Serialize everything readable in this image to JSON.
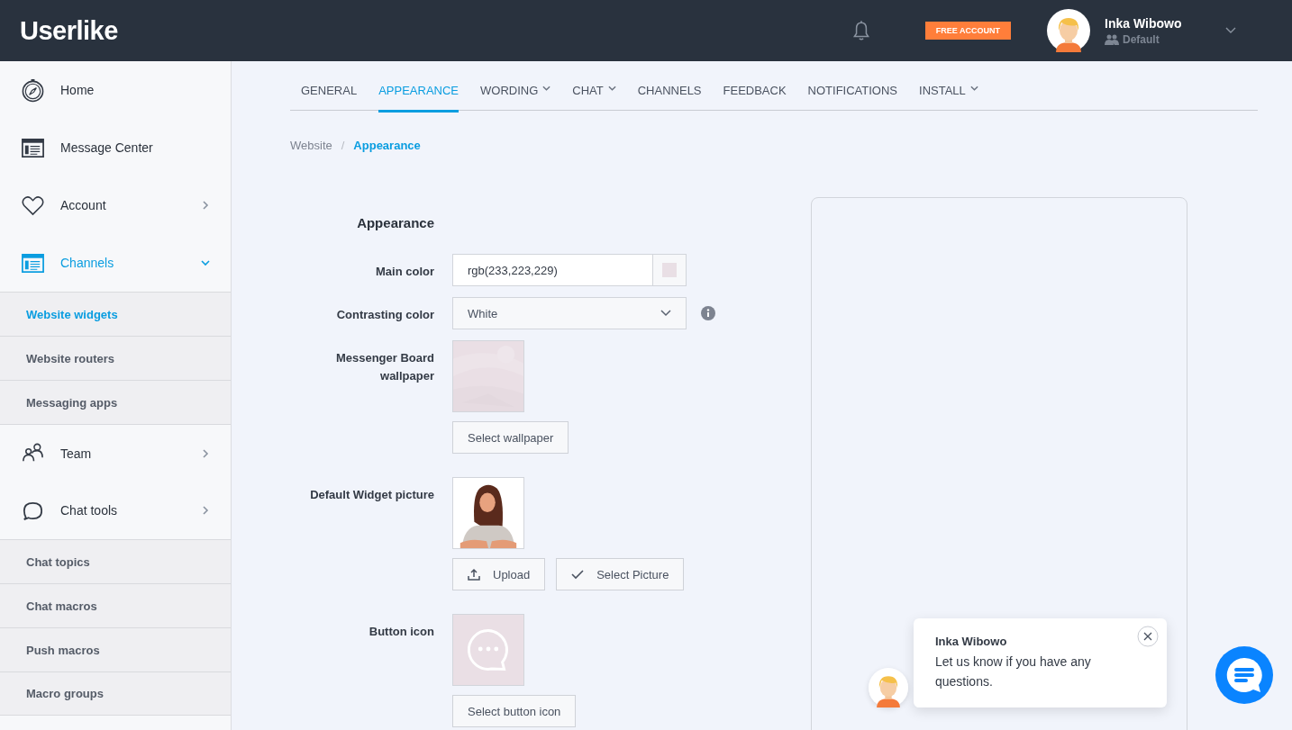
{
  "header": {
    "logo": "Userlike",
    "badge": "FREE ACCOUNT",
    "user": {
      "name": "Inka Wibowo",
      "role": "Default"
    }
  },
  "sidebar": {
    "items": [
      {
        "label": "Home",
        "selected": false
      },
      {
        "label": "Message Center",
        "selected": false
      },
      {
        "label": "Account",
        "selected": false,
        "expanded": false
      },
      {
        "label": "Channels",
        "selected": true,
        "expanded": true,
        "children": [
          {
            "label": "Website widgets",
            "selected": true
          },
          {
            "label": "Website routers",
            "selected": false
          },
          {
            "label": "Messaging apps",
            "selected": false
          }
        ]
      },
      {
        "label": "Team",
        "selected": false,
        "expanded": false
      },
      {
        "label": "Chat tools",
        "selected": false,
        "expanded": false,
        "children": [
          {
            "label": "Chat topics",
            "selected": false
          },
          {
            "label": "Chat macros",
            "selected": false
          },
          {
            "label": "Push macros",
            "selected": false
          },
          {
            "label": "Macro groups",
            "selected": false
          }
        ]
      }
    ]
  },
  "tabs": [
    {
      "label": "GENERAL",
      "selected": false,
      "dropdown": false
    },
    {
      "label": "APPEARANCE",
      "selected": true,
      "dropdown": false
    },
    {
      "label": "WORDING",
      "selected": false,
      "dropdown": true
    },
    {
      "label": "CHAT",
      "selected": false,
      "dropdown": true
    },
    {
      "label": "CHANNELS",
      "selected": false,
      "dropdown": false
    },
    {
      "label": "FEEDBACK",
      "selected": false,
      "dropdown": false
    },
    {
      "label": "NOTIFICATIONS",
      "selected": false,
      "dropdown": false
    },
    {
      "label": "INSTALL",
      "selected": false,
      "dropdown": true
    }
  ],
  "breadcrumb": {
    "separator": "/",
    "items": [
      "Website",
      "Appearance"
    ]
  },
  "form": {
    "title": "Appearance",
    "fields": [
      {
        "kind": "color",
        "label": "Main color",
        "value": "rgb(233,223,229)",
        "color": "#e9dfe5"
      },
      {
        "kind": "select",
        "label": "Contrasting color",
        "value": "White",
        "info": true
      },
      {
        "kind": "wallpaper",
        "label": "Messenger Board wallpaper",
        "buttons": [
          {
            "label": "Select wallpaper",
            "kind": "plain"
          }
        ]
      },
      {
        "label": "Default Widget picture",
        "buttons": [
          {
            "label": "Upload",
            "kind": "upload"
          },
          {
            "label": "Select Picture",
            "kind": "check"
          }
        ]
      },
      {
        "kind": "icon",
        "label": "Button icon",
        "buttons": [
          {
            "label": "Select button icon",
            "kind": "plain"
          }
        ]
      }
    ]
  },
  "preview": {
    "popup": {
      "name": "Inka Wibowo",
      "message": "Let us know if you have any questions."
    }
  }
}
